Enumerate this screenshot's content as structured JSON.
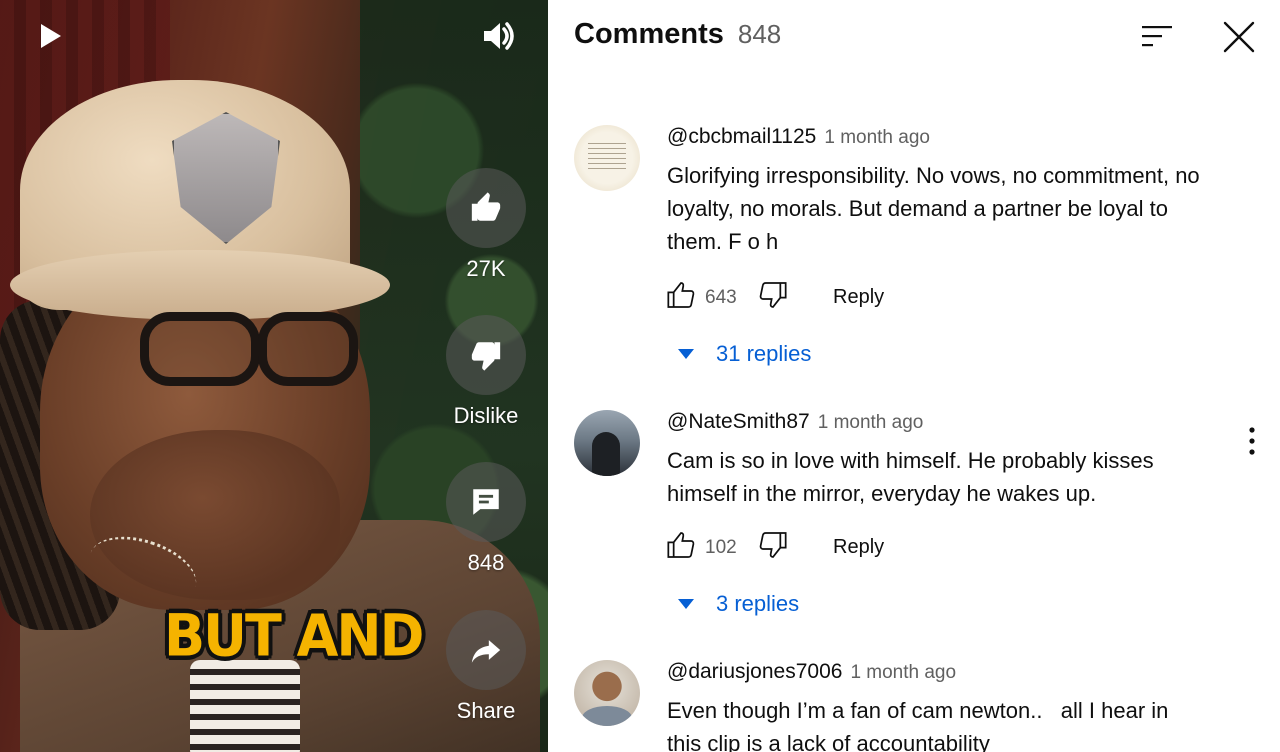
{
  "video": {
    "caption": "BUT AND",
    "actions": {
      "like_count": "27K",
      "dislike_label": "Dislike",
      "comments_count": "848",
      "share_label": "Share"
    }
  },
  "comments_panel": {
    "title": "Comments",
    "count": "848",
    "comments": [
      {
        "username": "@cbcbmail1125",
        "time": "1 month ago",
        "text": "Glorifying irresponsibility. No vows, no commitment, no loyalty, no morals. But demand a partner be loyal to them. F o h",
        "likes": "643",
        "reply_label": "Reply",
        "replies_label": "31 replies"
      },
      {
        "username": "@NateSmith87",
        "time": "1 month ago",
        "text": "Cam is so in love with himself. He probably kisses himself in the mirror, everyday he wakes up.",
        "likes": "102",
        "reply_label": "Reply",
        "replies_label": "3 replies"
      },
      {
        "username": "@dariusjones7006",
        "time": "1 month ago",
        "text": "Even though I’m a fan of cam newton..   all I hear in this clip is a lack of accountability"
      }
    ]
  },
  "icons": [
    "play-icon",
    "volume-icon",
    "thumbs-up-icon",
    "thumbs-down-icon",
    "comment-icon",
    "share-icon",
    "sort-icon",
    "close-icon",
    "more-vert-icon"
  ],
  "colors": {
    "link_blue": "#065fd4",
    "caption_yellow": "#f5b300",
    "secondary_text": "#606060"
  }
}
